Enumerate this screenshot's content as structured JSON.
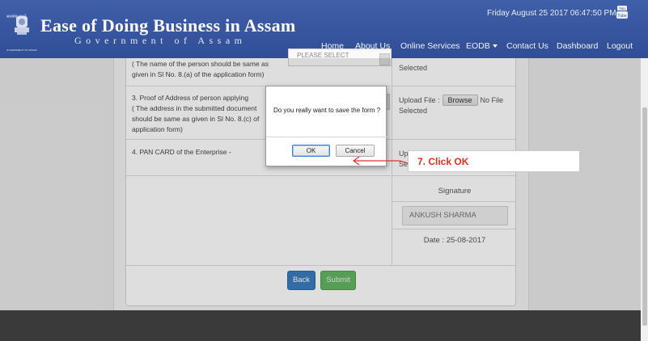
{
  "header": {
    "brand_title": "Ease of Doing Business in Assam",
    "brand_subtitle": "Government of Assam",
    "emblem_top_text": "सत्यमेव जयते",
    "emblem_bottom_text": "GOVERNMENT OF ASSAM",
    "datetime": "Friday August 25 2017 06:47:50 PM",
    "colors": {
      "bar": "#33529a",
      "text": "#ffffff"
    }
  },
  "nav": [
    {
      "label": "Home"
    },
    {
      "label": "About Us"
    },
    {
      "label": "Online Services"
    },
    {
      "label": "EODB"
    },
    {
      "label": "Contact Us"
    },
    {
      "label": "Dashboard"
    },
    {
      "label": "Logout"
    }
  ],
  "form": {
    "row2_text": "( The name of the person should be same as given in Sl No. 8.(a) of the application form)",
    "row2_select": "PLEASE SELECT",
    "row2_upload_tail": "Selected",
    "row3_text_l1": "3. Proof of Address of person applying",
    "row3_text_l2": "( The address in the submitted document",
    "row3_text_l3": "should be same as given in Sl No. 8.(c) of",
    "row3_text_l4": "application form)",
    "row3_upload_label": "Upload File :",
    "row3_browse": "Browse",
    "row3_nofile": "No File",
    "row3_selected": "Selected",
    "row4_text": "4. PAN CARD of the Enterprise -",
    "row4_upload_label": "Upl",
    "row4_selected": "Se",
    "signature_label": "Signature",
    "signature_value": "ANKUSH SHARMA",
    "date": "Date : 25-08-2017",
    "back_button": "Back",
    "submit_button": "Submit"
  },
  "modal": {
    "message": "Do you really want to save the form ?",
    "ok_button": "OK",
    "cancel_button": "Cancel"
  },
  "callout": {
    "text": "7. Click OK",
    "color": "#e0301e"
  }
}
